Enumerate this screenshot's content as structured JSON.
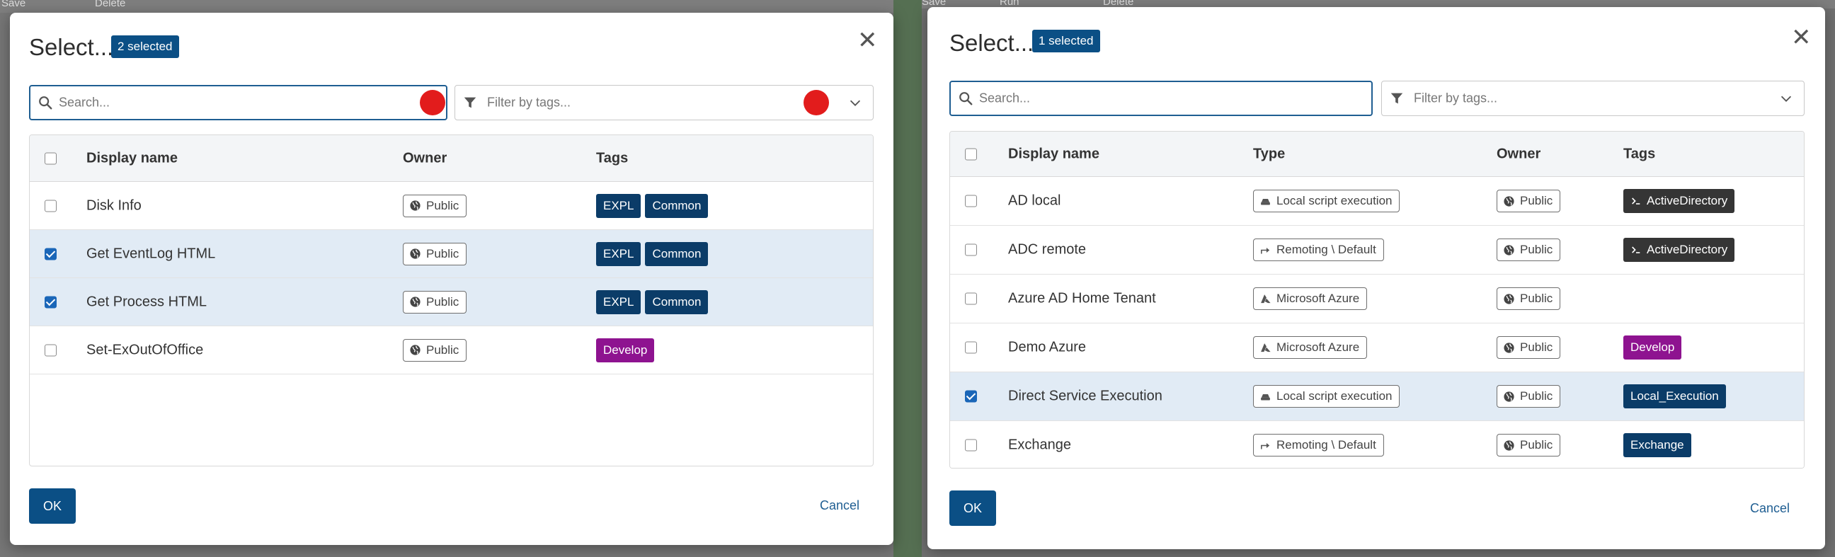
{
  "background": {
    "left_toolbar": {
      "save": "Save",
      "delete": "Delete"
    },
    "right_toolbar": {
      "save": "Save",
      "run": "Run",
      "delete": "Delete"
    }
  },
  "colors": {
    "accent": "#0b4f85",
    "selected_row": "#e1ebf5",
    "tag_blue": "#0b3c68",
    "tag_purple": "#8e1390",
    "tag_dark": "#353535",
    "marker": "#e21c1c"
  },
  "left_dialog": {
    "title": "Select...",
    "badge": "2 selected",
    "search_placeholder": "Search...",
    "filter_placeholder": "Filter by tags...",
    "columns": {
      "name": "Display name",
      "owner": "Owner",
      "tags": "Tags"
    },
    "rows": [
      {
        "name": "Disk Info",
        "owner": "Public",
        "checked": false,
        "tags": [
          "EXPL",
          "Common"
        ]
      },
      {
        "name": "Get EventLog HTML",
        "owner": "Public",
        "checked": true,
        "tags": [
          "EXPL",
          "Common"
        ]
      },
      {
        "name": "Get Process HTML",
        "owner": "Public",
        "checked": true,
        "tags": [
          "EXPL",
          "Common"
        ]
      },
      {
        "name": "Set-ExOutOfOffice",
        "owner": "Public",
        "checked": false,
        "tags": [
          "Develop"
        ]
      }
    ],
    "ok": "OK",
    "cancel": "Cancel"
  },
  "right_dialog": {
    "title": "Select...",
    "badge": "1 selected",
    "search_placeholder": "Search...",
    "filter_placeholder": "Filter by tags...",
    "columns": {
      "name": "Display name",
      "type": "Type",
      "owner": "Owner",
      "tags": "Tags"
    },
    "rows": [
      {
        "name": "AD local",
        "type": "Local script execution",
        "type_icon": "server-icon",
        "owner": "Public",
        "checked": false,
        "tag": "ActiveDirectory",
        "tag_style": "dark"
      },
      {
        "name": "ADC remote",
        "type": "Remoting \\ Default",
        "type_icon": "remote-arrow-icon",
        "owner": "Public",
        "checked": false,
        "tag": "ActiveDirectory",
        "tag_style": "dark"
      },
      {
        "name": "Azure AD Home Tenant",
        "type": "Microsoft Azure",
        "type_icon": "azure-icon",
        "owner": "Public",
        "checked": false,
        "tag": "",
        "tag_style": ""
      },
      {
        "name": "Demo Azure",
        "type": "Microsoft Azure",
        "type_icon": "azure-icon",
        "owner": "Public",
        "checked": false,
        "tag": "Develop",
        "tag_style": "purple"
      },
      {
        "name": "Direct Service Execution",
        "type": "Local script execution",
        "type_icon": "server-icon",
        "owner": "Public",
        "checked": true,
        "tag": "Local_Execution",
        "tag_style": "blue"
      },
      {
        "name": "Exchange",
        "type": "Remoting \\ Default",
        "type_icon": "remote-arrow-icon",
        "owner": "Public",
        "checked": false,
        "tag": "Exchange",
        "tag_style": "blue"
      }
    ],
    "ok": "OK",
    "cancel": "Cancel"
  }
}
